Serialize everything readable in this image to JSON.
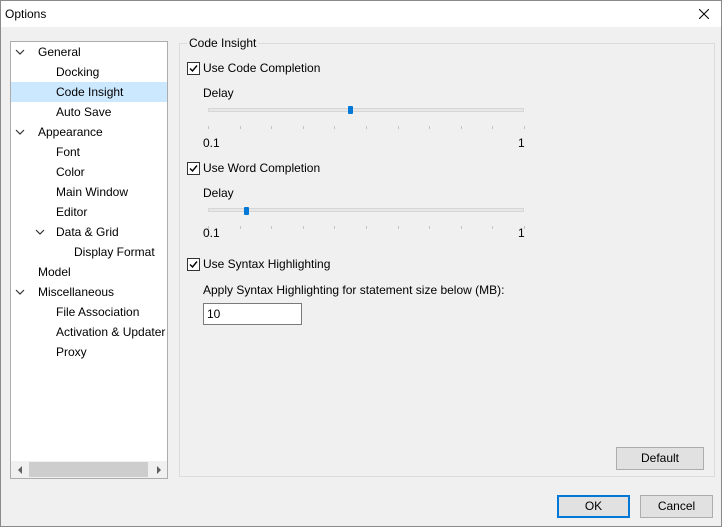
{
  "window": {
    "title": "Options"
  },
  "tree": {
    "items": [
      {
        "label": "General",
        "expanded": true
      },
      {
        "label": "Docking"
      },
      {
        "label": "Code Insight",
        "selected": true
      },
      {
        "label": "Auto Save"
      },
      {
        "label": "Appearance",
        "expanded": true
      },
      {
        "label": "Font"
      },
      {
        "label": "Color"
      },
      {
        "label": "Main Window"
      },
      {
        "label": "Editor"
      },
      {
        "label": "Data & Grid",
        "expanded": true
      },
      {
        "label": "Display Format"
      },
      {
        "label": "Model"
      },
      {
        "label": "Miscellaneous",
        "expanded": true
      },
      {
        "label": "File Association"
      },
      {
        "label": "Activation & Updater"
      },
      {
        "label": "Proxy"
      }
    ]
  },
  "panel": {
    "group_title": "Code Insight",
    "code_completion": {
      "label": "Use Code Completion",
      "checked": true,
      "delay_label": "Delay",
      "min_label": "0.1",
      "max_label": "1",
      "value_fraction": 0.45
    },
    "word_completion": {
      "label": "Use Word Completion",
      "checked": true,
      "delay_label": "Delay",
      "min_label": "0.1",
      "max_label": "1",
      "value_fraction": 0.12
    },
    "syntax_highlighting": {
      "label": "Use Syntax Highlighting",
      "checked": true,
      "size_label": "Apply Syntax Highlighting for statement size below (MB):",
      "size_value": "10"
    },
    "default_button": "Default"
  },
  "footer": {
    "ok_label": "OK",
    "cancel_label": "Cancel"
  },
  "colors": {
    "accent": "#0078d7",
    "selection": "#cce8ff"
  }
}
